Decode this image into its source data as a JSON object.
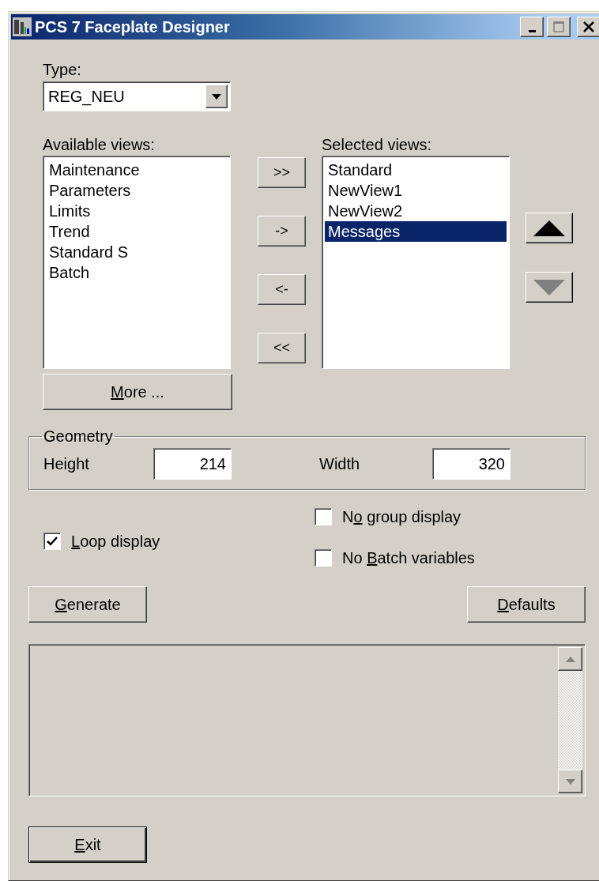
{
  "window": {
    "title": "PCS 7 Faceplate Designer"
  },
  "type": {
    "label": "Type:",
    "value": "REG_NEU"
  },
  "available_views": {
    "label": "Available views:",
    "items": [
      {
        "label": "Maintenance",
        "selected": false
      },
      {
        "label": "Parameters",
        "selected": false
      },
      {
        "label": "Limits",
        "selected": false
      },
      {
        "label": "Trend",
        "selected": false
      },
      {
        "label": "Standard S",
        "selected": false
      },
      {
        "label": "Batch",
        "selected": false
      }
    ]
  },
  "more_button": {
    "label": {
      "key": "M",
      "after": "ore ..."
    }
  },
  "transfer_buttons": [
    ">>",
    "->",
    "<-",
    "<<"
  ],
  "selected_views": {
    "label": "Selected views:",
    "items": [
      {
        "label": "Standard",
        "selected": false
      },
      {
        "label": "NewView1",
        "selected": false
      },
      {
        "label": "NewView2",
        "selected": false
      },
      {
        "label": "Messages",
        "selected": true
      }
    ]
  },
  "order_buttons": [
    {
      "kind": "up",
      "disabled": false
    },
    {
      "kind": "down",
      "disabled": true
    }
  ],
  "geometry": {
    "title": "Geometry",
    "fields": [
      {
        "label": "Height",
        "value": "214"
      },
      {
        "label": "Width",
        "value": "320"
      }
    ]
  },
  "checkbox_columns": [
    [
      {
        "label": {
          "key": "L",
          "after": "oop display"
        },
        "checked": true
      }
    ],
    [
      {
        "label": {
          "before": "N",
          "key": "o",
          "after": " group display"
        },
        "checked": false
      },
      {
        "label": {
          "before": "No ",
          "key": "B",
          "after": "atch variables"
        },
        "checked": false
      }
    ]
  ],
  "actions": [
    {
      "label": {
        "key": "G",
        "after": "enerate"
      }
    },
    {
      "label": {
        "key": "D",
        "after": "efaults"
      }
    }
  ],
  "exit_button": {
    "label": {
      "key": "E",
      "after": "xit"
    }
  }
}
